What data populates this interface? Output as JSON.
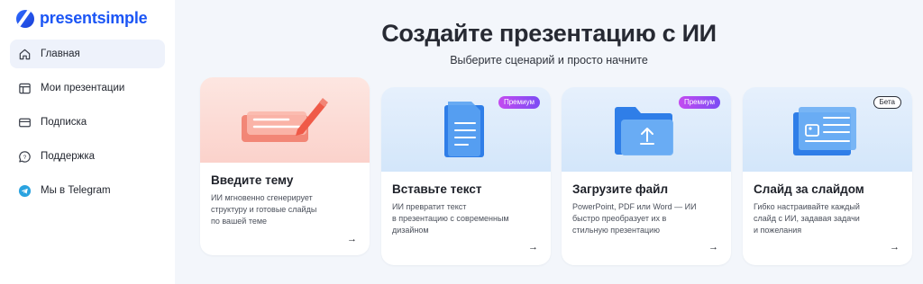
{
  "brand": {
    "name": "presentsimple"
  },
  "sidebar": {
    "items": [
      {
        "label": "Главная",
        "icon": "home-icon",
        "active": true
      },
      {
        "label": "Мои презентации",
        "icon": "layout-icon",
        "active": false
      },
      {
        "label": "Подписка",
        "icon": "card-icon",
        "active": false
      },
      {
        "label": "Поддержка",
        "icon": "chat-help-icon",
        "active": false
      },
      {
        "label": "Мы в Telegram",
        "icon": "telegram-icon",
        "active": false
      }
    ]
  },
  "main": {
    "title": "Создайте презентацию с ИИ",
    "subtitle": "Выберите сценарий и просто начните",
    "cards": [
      {
        "title": "Введите тему",
        "desc": [
          "ИИ мгновенно сгенерирует",
          "структуру и готовые слайды",
          "по вашей теме"
        ],
        "badge": "",
        "icon": "pen-text-icon",
        "arrow": "→"
      },
      {
        "title": "Вставьте текст",
        "desc": [
          "ИИ превратит текст",
          "в презентацию с современным",
          "дизайном"
        ],
        "badge": "Премиум",
        "icon": "document-icon",
        "arrow": "→"
      },
      {
        "title": "Загрузите файл",
        "desc": [
          "PowerPoint, PDF или Word — ИИ",
          "быстро преобразует их в",
          "стильную презентацию"
        ],
        "badge": "Премиум",
        "icon": "folder-upload-icon",
        "arrow": "→"
      },
      {
        "title": "Слайд за слайдом",
        "desc": [
          "Гибко настраивайте каждый",
          "слайд с ИИ, задавая задачи",
          "и пожелания"
        ],
        "badge": "Бета",
        "icon": "slides-icon",
        "arrow": "→"
      }
    ]
  },
  "colors": {
    "brand": "#1b55f5",
    "card1_top": "#fde3de",
    "card_top": "#dcebfb",
    "premium": "#a14cf2"
  }
}
